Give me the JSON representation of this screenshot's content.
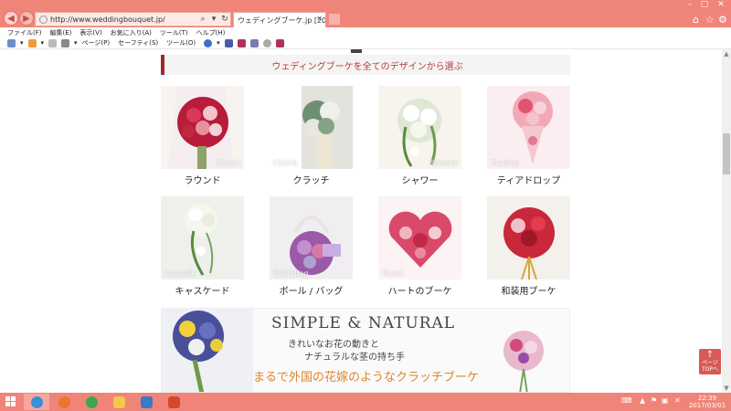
{
  "browser": {
    "url": "http://www.weddingbouquet.jp/",
    "tab_title": "ウェディングブーケ.jp [2017...",
    "window_controls": {
      "minimize": "–",
      "maximize": "▢",
      "close": "✕"
    },
    "right_icons": [
      "home-icon",
      "star-icon",
      "gear-icon"
    ]
  },
  "menubar": {
    "items": [
      "ファイル(F)",
      "編集(E)",
      "表示(V)",
      "お気に入り(A)",
      "ツール(T)",
      "ヘルプ(H)"
    ]
  },
  "commandbar": {
    "page_label": "ページ(P)",
    "safety_label": "セーフティ(S)",
    "tools_label": "ツール(O)"
  },
  "page": {
    "section_title": "ウェディングブーケを全てのデザインから選ぶ",
    "bouquets": [
      {
        "caption": "ラウンド",
        "en": "Round"
      },
      {
        "caption": "クラッチ",
        "en": "Clutch"
      },
      {
        "caption": "シャワー",
        "en": "Shower"
      },
      {
        "caption": "ティアドロップ",
        "en": "Tiadrop"
      },
      {
        "caption": "キャスケード",
        "en": "Cascade"
      },
      {
        "caption": "ボール / バッグ",
        "en": "Ball&Bag"
      },
      {
        "caption": "ハートのブーケ",
        "en": "Heart"
      },
      {
        "caption": "和装用ブーケ",
        "en": ""
      }
    ],
    "banner": {
      "title": "SIMPLE  &  NATURAL",
      "sub1": "きれいなお花の動きと",
      "sub2": "ナチュラルな茎の持ち手",
      "main": "まるで外国の花嫁のようなクラッチブーケ"
    },
    "page_top": {
      "label1": "ページ",
      "label2": "TOPへ"
    }
  },
  "taskbar": {
    "time": "22:39",
    "date": "2017/03/01"
  },
  "colors": {
    "accent": "#f0857a",
    "section_border": "#a2282d",
    "banner_orange": "#e0852d"
  }
}
